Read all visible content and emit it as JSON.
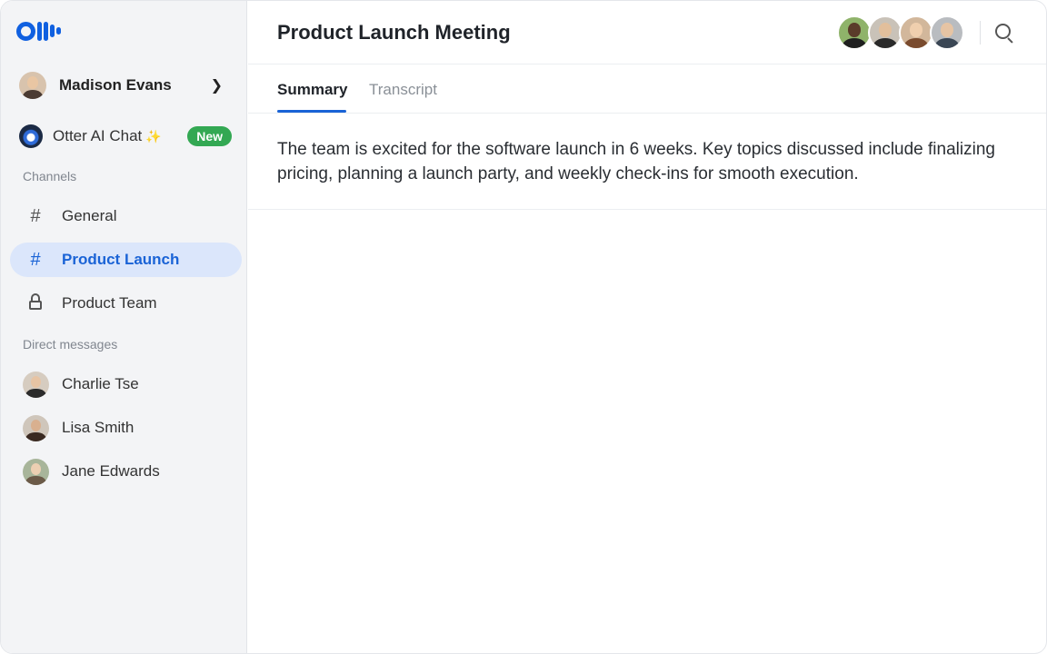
{
  "sidebar": {
    "user": {
      "name": "Madison Evans"
    },
    "ai_chat": {
      "label": "Otter AI Chat",
      "sparkle": "✨",
      "badge": "New"
    },
    "channels_label": "Channels",
    "channels": [
      {
        "label": "General",
        "icon": "#"
      },
      {
        "label": "Product Launch",
        "icon": "#",
        "active": true
      },
      {
        "label": "Product Team",
        "icon": "lock"
      }
    ],
    "dm_label": "Direct messages",
    "direct_messages": [
      {
        "label": "Charlie Tse"
      },
      {
        "label": "Lisa Smith"
      },
      {
        "label": "Jane Edwards"
      }
    ]
  },
  "header": {
    "title": "Product Launch Meeting",
    "participant_count": 4
  },
  "tabs": [
    {
      "label": "Summary",
      "active": true
    },
    {
      "label": "Transcript",
      "active": false
    }
  ],
  "summary": {
    "text": "The team is excited for the software launch in 6 weeks. Key topics discussed include finalizing pricing, planning a launch party, and weekly check-ins for smooth execution."
  },
  "colors": {
    "accent": "#1a63d6",
    "active_bg": "#dbe6fb",
    "badge": "#33a853",
    "sidebar_bg": "#f3f4f6",
    "logo": "#1060e0"
  }
}
